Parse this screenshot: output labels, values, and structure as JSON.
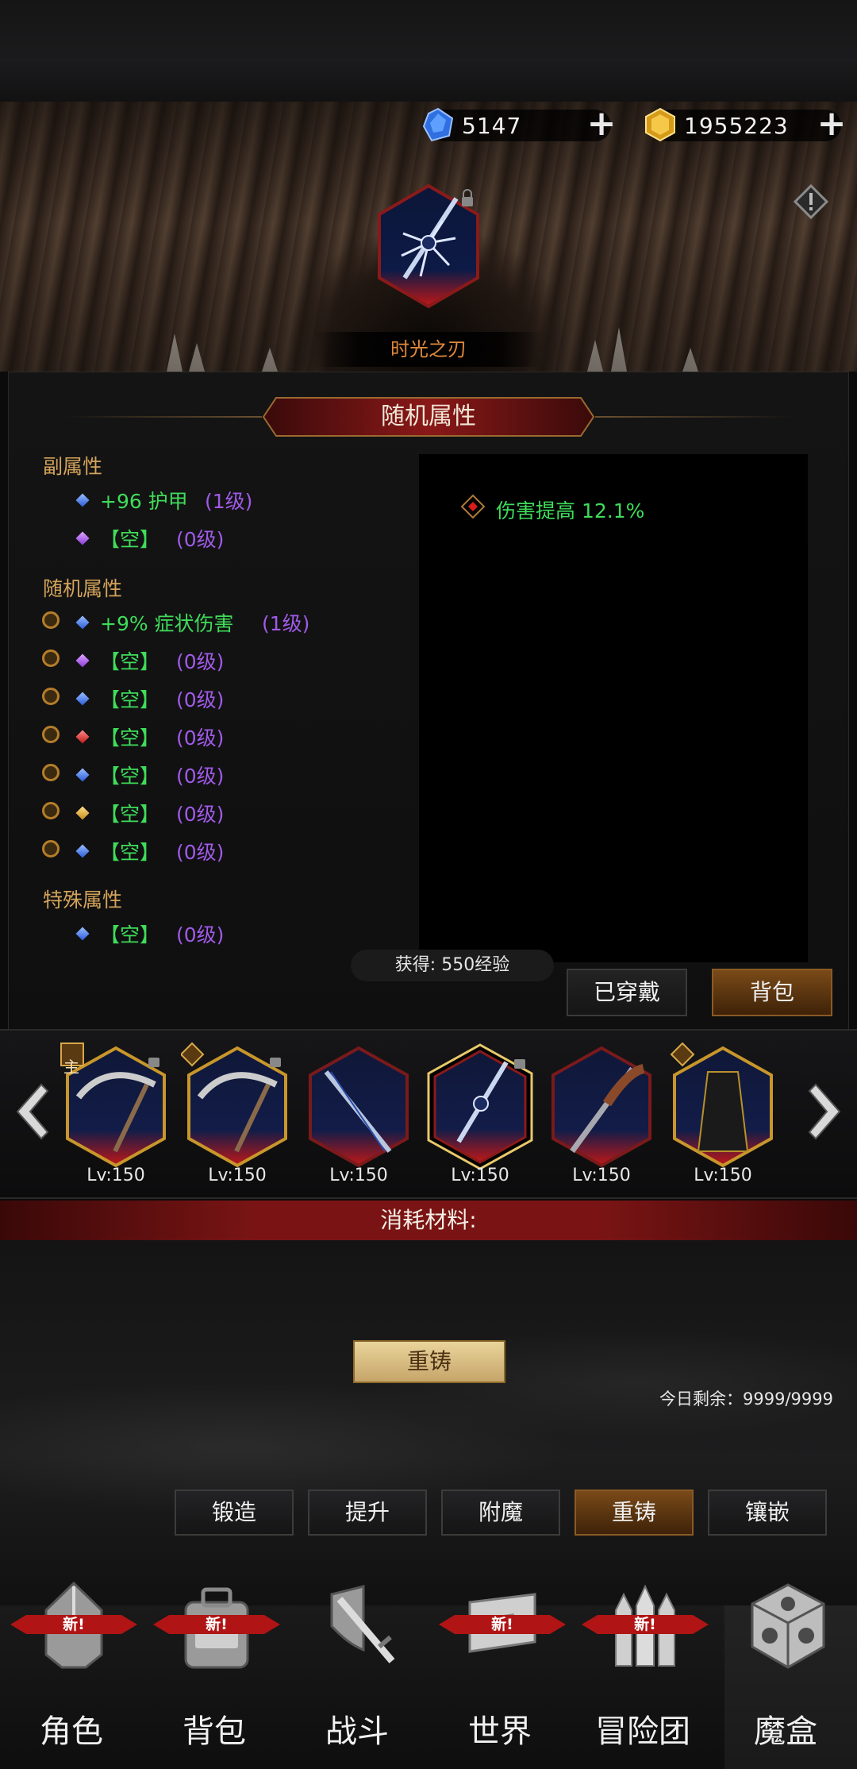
{
  "currency": {
    "gems": "5147",
    "gold": "1955223"
  },
  "item": {
    "name": "时光之刃"
  },
  "panel": {
    "title": "随机属性",
    "sub_title": "副属性",
    "sub_rows": [
      {
        "value": "+96 护甲",
        "level": "(1级)"
      },
      {
        "value": "【空】",
        "level": "(0级)"
      }
    ],
    "random_title": "随机属性",
    "random_rows": [
      {
        "value": "+9% 症状伤害",
        "level": "(1级)"
      },
      {
        "value": "【空】",
        "level": "(0级)"
      },
      {
        "value": "【空】",
        "level": "(0级)"
      },
      {
        "value": "【空】",
        "level": "(0级)"
      },
      {
        "value": "【空】",
        "level": "(0级)"
      },
      {
        "value": "【空】",
        "level": "(0级)"
      },
      {
        "value": "【空】",
        "level": "(0级)"
      }
    ],
    "special_title": "特殊属性",
    "special_rows": [
      {
        "value": "【空】",
        "level": "(0级)"
      }
    ],
    "effect": "伤害提高 12.1%",
    "gain": "获得: 550经验",
    "equipped_label": "已穿戴",
    "bag_label": "背包"
  },
  "carousel": {
    "items": [
      {
        "level": "Lv:150",
        "tag": "主"
      },
      {
        "level": "Lv:150"
      },
      {
        "level": "Lv:150"
      },
      {
        "level": "Lv:150"
      },
      {
        "level": "Lv:150"
      },
      {
        "level": "Lv:150"
      }
    ]
  },
  "materials_label": "消耗材料:",
  "recast_button": "重铸",
  "today_left": "今日剩余：9999/9999",
  "tabs": [
    "锻造",
    "提升",
    "附魔",
    "重铸",
    "镶嵌"
  ],
  "nav": [
    {
      "label": "角色",
      "new": "新!"
    },
    {
      "label": "背包",
      "new": "新!"
    },
    {
      "label": "战斗"
    },
    {
      "label": "世界",
      "new": "新!"
    },
    {
      "label": "冒险团",
      "new": "新!"
    },
    {
      "label": "魔盒"
    }
  ],
  "colors": {
    "accent_gold": "#d3a35a",
    "attr_green": "#3fdc5a",
    "attr_purple": "#a05ae8",
    "item_name": "#e0883a"
  }
}
